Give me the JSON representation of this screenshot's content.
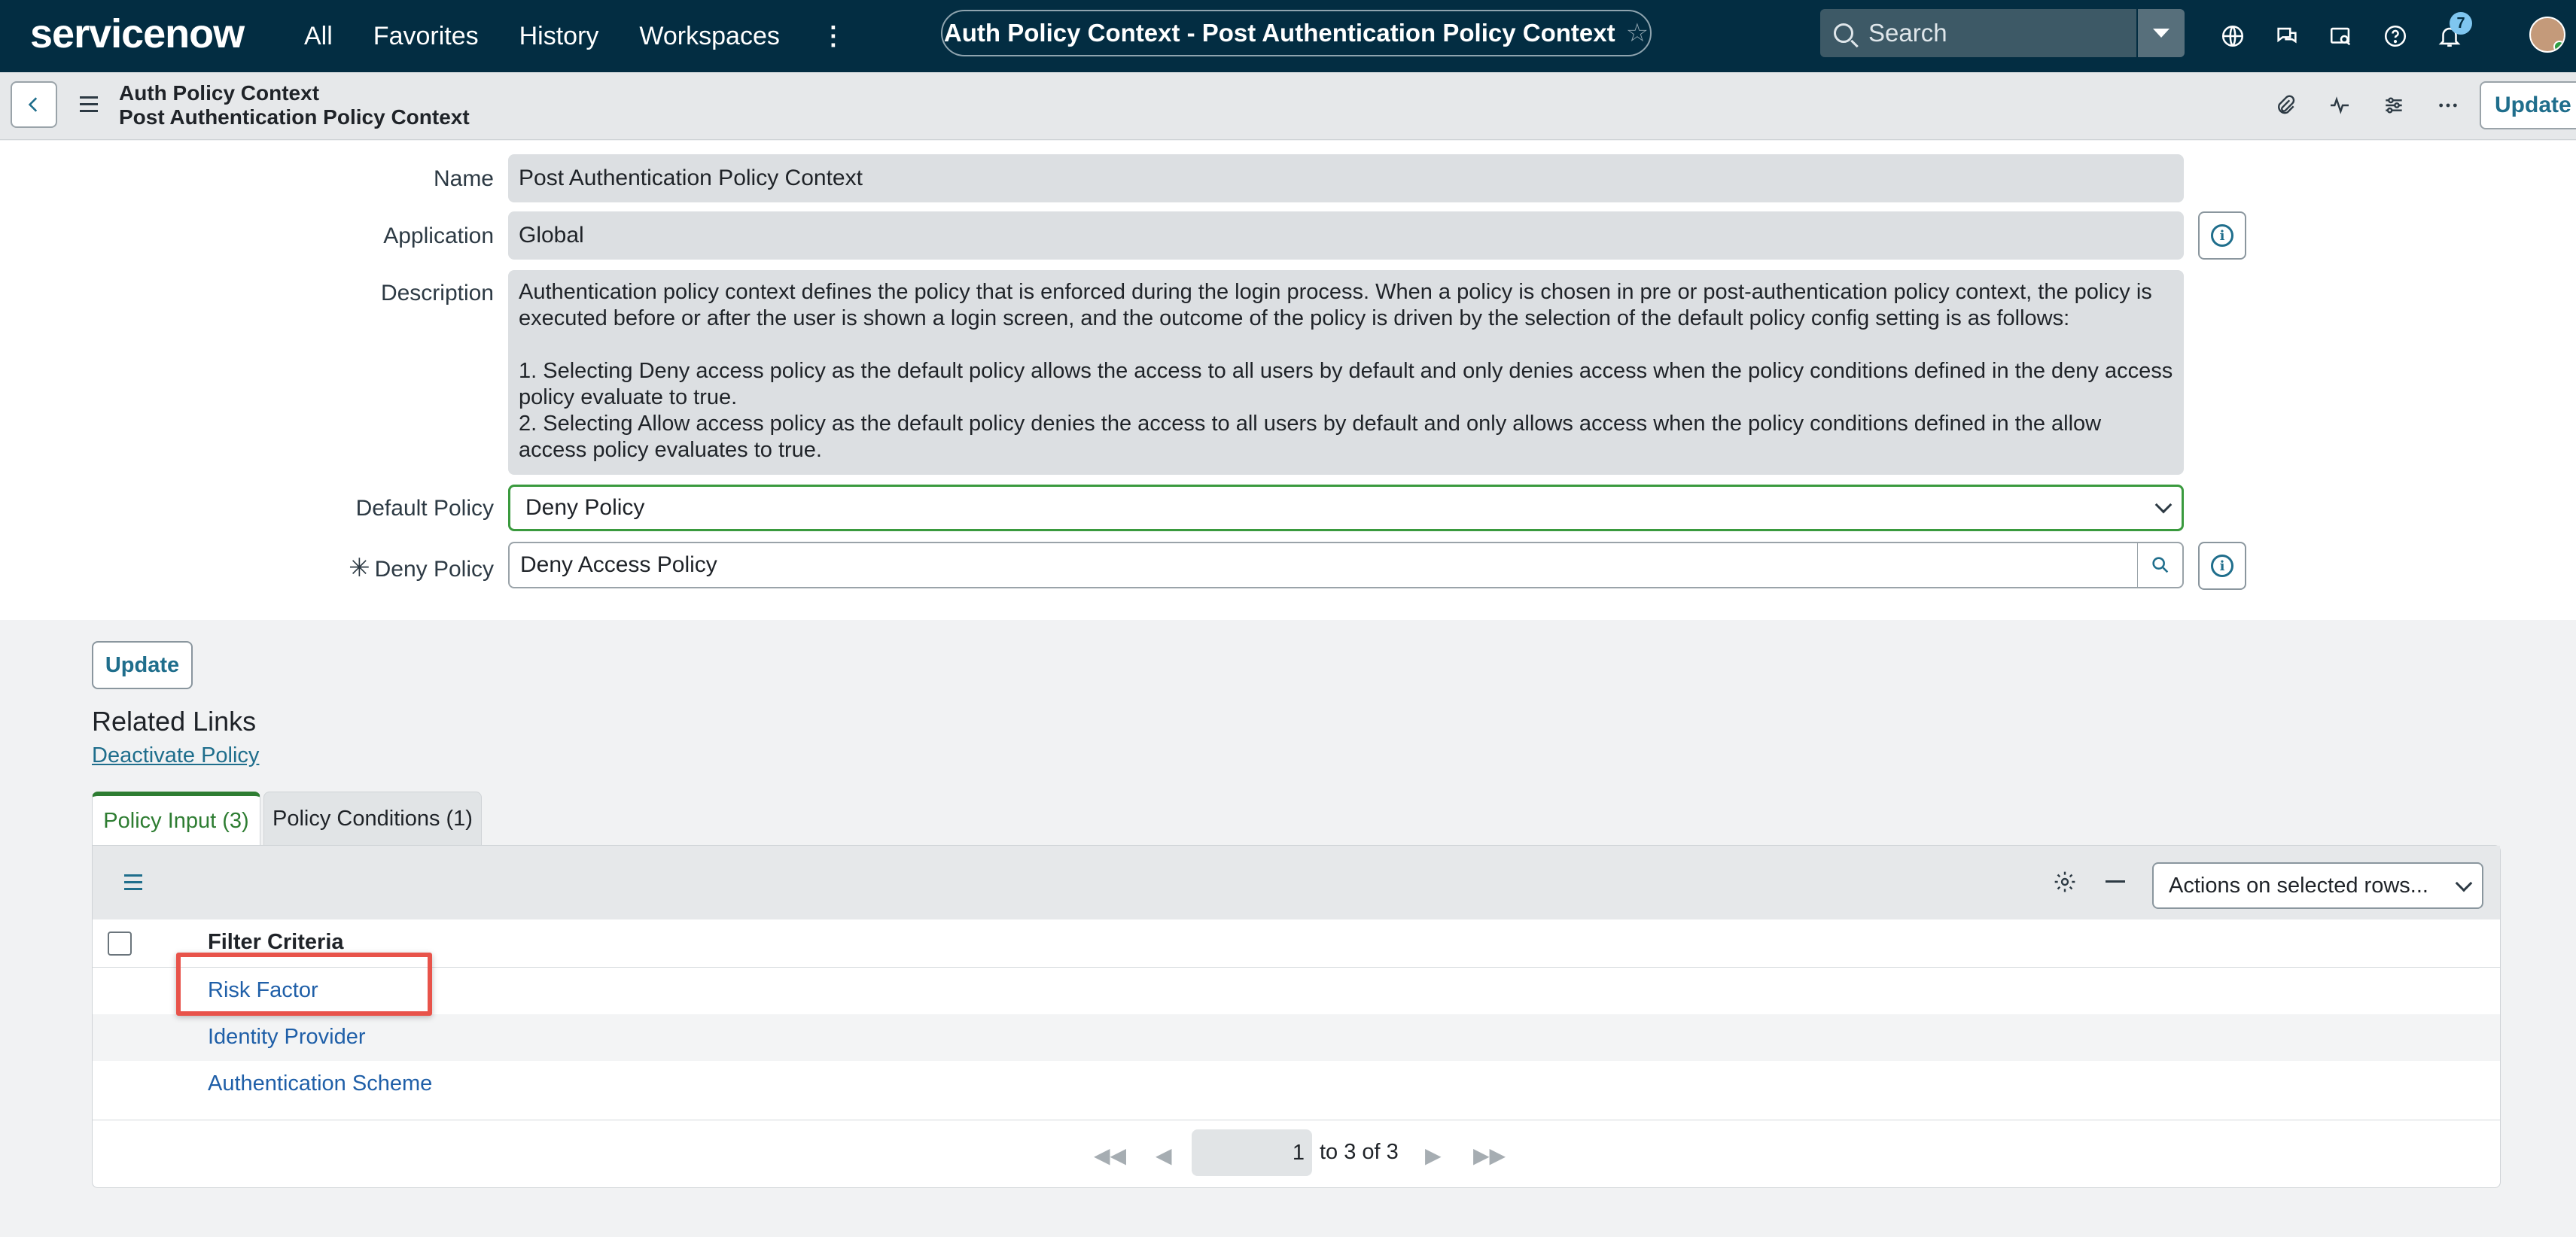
{
  "topnav": {
    "logo": "servicenow",
    "menu": [
      "All",
      "Favorites",
      "History",
      "Workspaces"
    ],
    "more": "⋮",
    "context_title": "Auth Policy Context - Post Authentication Policy Context",
    "search_placeholder": "Search",
    "notification_count": "7"
  },
  "record_header": {
    "title_line1": "Auth Policy Context",
    "title_line2": "Post Authentication Policy Context",
    "update_label": "Update"
  },
  "form": {
    "name_label": "Name",
    "name_value": "Post Authentication Policy Context",
    "application_label": "Application",
    "application_value": "Global",
    "description_label": "Description",
    "description_p1": "Authentication policy context defines the policy that is enforced during the login process. When a policy is chosen in pre or post-authentication policy context, the policy is executed before or after the user is shown a login screen, and the outcome of the policy is driven by the selection of the default policy config setting is as follows:",
    "description_p2": "1. Selecting Deny access policy as the default policy allows the access to all users by default and only denies access when the policy conditions defined in the deny access policy evaluate to true.",
    "description_p3": "2. Selecting Allow access policy as the default policy denies the access to all users by default and only allows access when the policy conditions defined in the allow access policy evaluates to true.",
    "default_policy_label": "Default Policy",
    "default_policy_value": "Deny Policy",
    "deny_policy_label": "Deny Policy",
    "deny_policy_value": "Deny Access Policy"
  },
  "lower": {
    "update_label": "Update",
    "related_links_title": "Related Links",
    "deactivate_link": "Deactivate Policy"
  },
  "tabs": [
    {
      "label": "Policy Input (3)",
      "active": true
    },
    {
      "label": "Policy Conditions (1)",
      "active": false
    }
  ],
  "list": {
    "actions_label": "Actions on selected rows...",
    "column_header": "Filter Criteria",
    "rows": [
      "Risk Factor",
      "Identity Provider",
      "Authentication Scheme"
    ],
    "pager_page": "1",
    "pager_text": "to 3 of 3"
  },
  "colors": {
    "nav_bg": "#032d42",
    "accent_green": "#2e7d32",
    "link_blue": "#1f5fa8",
    "highlight_red": "#e8534a"
  }
}
